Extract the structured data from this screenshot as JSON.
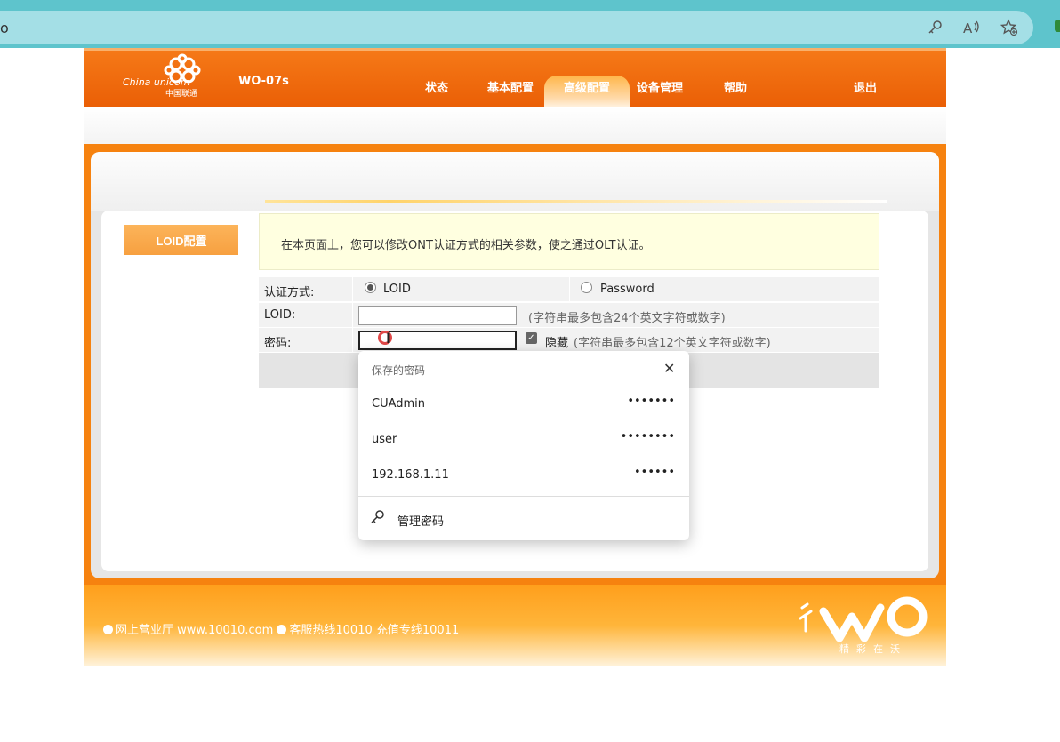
{
  "browser": {
    "url_fragment": "o",
    "icons": [
      "key-icon",
      "read-aloud-icon",
      "favorite-star-icon"
    ]
  },
  "header": {
    "logo_en": "China unicom",
    "logo_cn": "中国联通",
    "model": "WO-07s",
    "nav": [
      "状态",
      "基本配置",
      "高级配置",
      "设备管理",
      "帮助"
    ],
    "active_nav": "高级配置",
    "logout": "退出"
  },
  "sidebar": {
    "active_item": "LOID配置"
  },
  "info": {
    "text": "在本页面上，您可以修改ONT认证方式的相关参数，使之通过OLT认证。"
  },
  "form": {
    "auth_label": "认证方式:",
    "auth_options": [
      "LOID",
      "Password"
    ],
    "auth_selected": "LOID",
    "loid_label": "LOID:",
    "loid_value": "",
    "loid_hint": "(字符串最多包含24个英文字符或数字)",
    "password_label": "密码:",
    "password_value": "",
    "hide_label": "隐藏",
    "hide_checked": true,
    "password_hint": "(字符串最多包含12个英文字符或数字)"
  },
  "password_dropdown": {
    "title": "保存的密码",
    "items": [
      {
        "user": "CUAdmin",
        "dots": "•••••••"
      },
      {
        "user": "user",
        "dots": "••••••••"
      },
      {
        "user": "192.168.1.11",
        "dots": "••••••"
      }
    ],
    "manage_label": "管理密码"
  },
  "footer": {
    "link1": "网上营业厅",
    "url": "www.10010.com",
    "hotline": "客服热线10010",
    "recharge": "充值专线10011",
    "slogan": "精彩在沃"
  },
  "colors": {
    "brand_orange": "#ea5f06",
    "footer_orange": "#ffb53a",
    "info_bg": "#ffffe0"
  }
}
